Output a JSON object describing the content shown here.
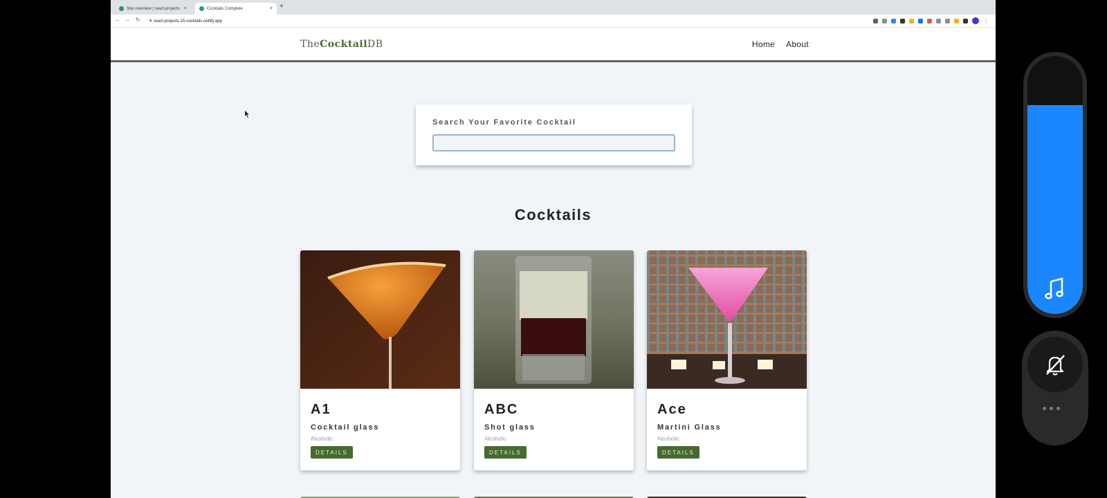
{
  "browser": {
    "tabs": [
      {
        "label": "Site overview | react-projects"
      },
      {
        "label": "Cocktails Complete"
      }
    ],
    "url": "react-projects-15-cocktails.netlify.app"
  },
  "navbar": {
    "logo_prefix": "The",
    "logo_bold": "Cocktail",
    "logo_suffix": "DB",
    "links": [
      {
        "label": "Home"
      },
      {
        "label": "About"
      }
    ]
  },
  "search": {
    "label": "Search Your Favorite Cocktail",
    "value": ""
  },
  "section_title": "Cocktails",
  "cocktails": [
    {
      "name": "A1",
      "glass": "Cocktail glass",
      "info": "Alcoholic",
      "button": "DETAILS",
      "image": "orange-martini-cocktail"
    },
    {
      "name": "ABC",
      "glass": "Shot glass",
      "info": "Alcoholic",
      "button": "DETAILS",
      "image": "layered-shot"
    },
    {
      "name": "Ace",
      "glass": "Martini Glass",
      "info": "Alcoholic",
      "button": "DETAILS",
      "image": "pink-martini-cocktail"
    }
  ],
  "colors": {
    "accent_green": "#476a2e",
    "page_bg": "#f1f5f8",
    "volume_blue": "#1a87ff"
  },
  "phone_panel": {
    "volume_level": 0.81,
    "icons": [
      "music-note-icon",
      "bell-off-icon",
      "more-dots-icon"
    ]
  }
}
